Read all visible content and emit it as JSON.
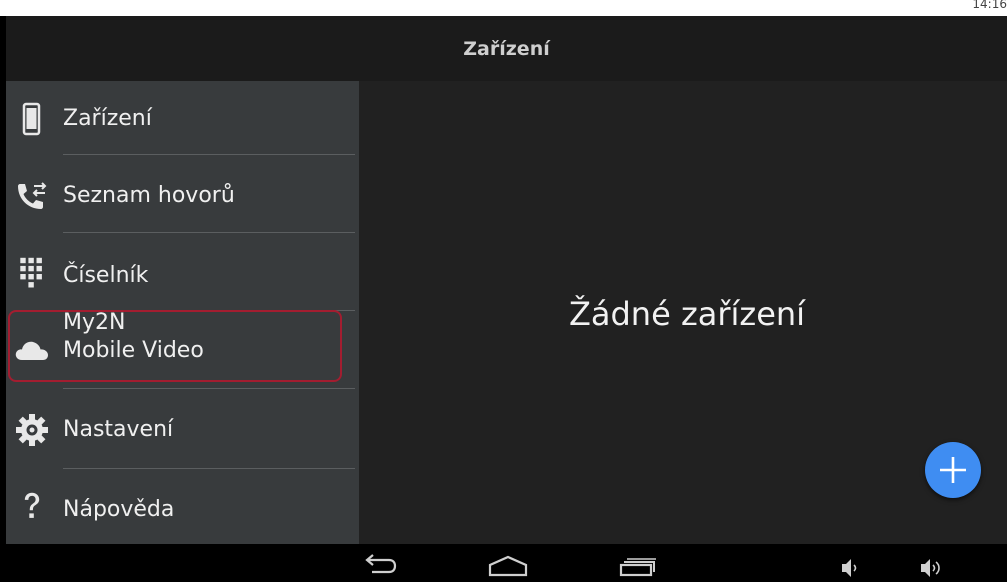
{
  "status_bar": {
    "time": "14:16"
  },
  "app_bar": {
    "title": "Zařízení"
  },
  "drawer": {
    "items": [
      {
        "label": "Zařízení",
        "icon": "smartphone-icon"
      },
      {
        "label": "Seznam hovorů",
        "icon": "call-log-icon"
      },
      {
        "label": "Číselník",
        "icon": "dialpad-icon"
      },
      {
        "label_line1": "My2N",
        "label_line2": "Mobile Video",
        "icon": "cloud-icon",
        "highlighted": true
      },
      {
        "label": "Nastavení",
        "icon": "gear-icon"
      },
      {
        "label": "Nápověda",
        "icon": "help-icon"
      }
    ]
  },
  "content": {
    "empty_message": "Žádné zařízení"
  },
  "fab": {
    "icon": "plus-icon",
    "color": "#3f8df2"
  },
  "nav_bar": {
    "buttons": [
      "back-icon",
      "home-icon",
      "recents-icon",
      "volume-down-icon",
      "volume-up-icon"
    ]
  },
  "colors": {
    "drawer_bg": "#383b3d",
    "content_bg": "#212121",
    "highlight_border": "#a31d30"
  }
}
